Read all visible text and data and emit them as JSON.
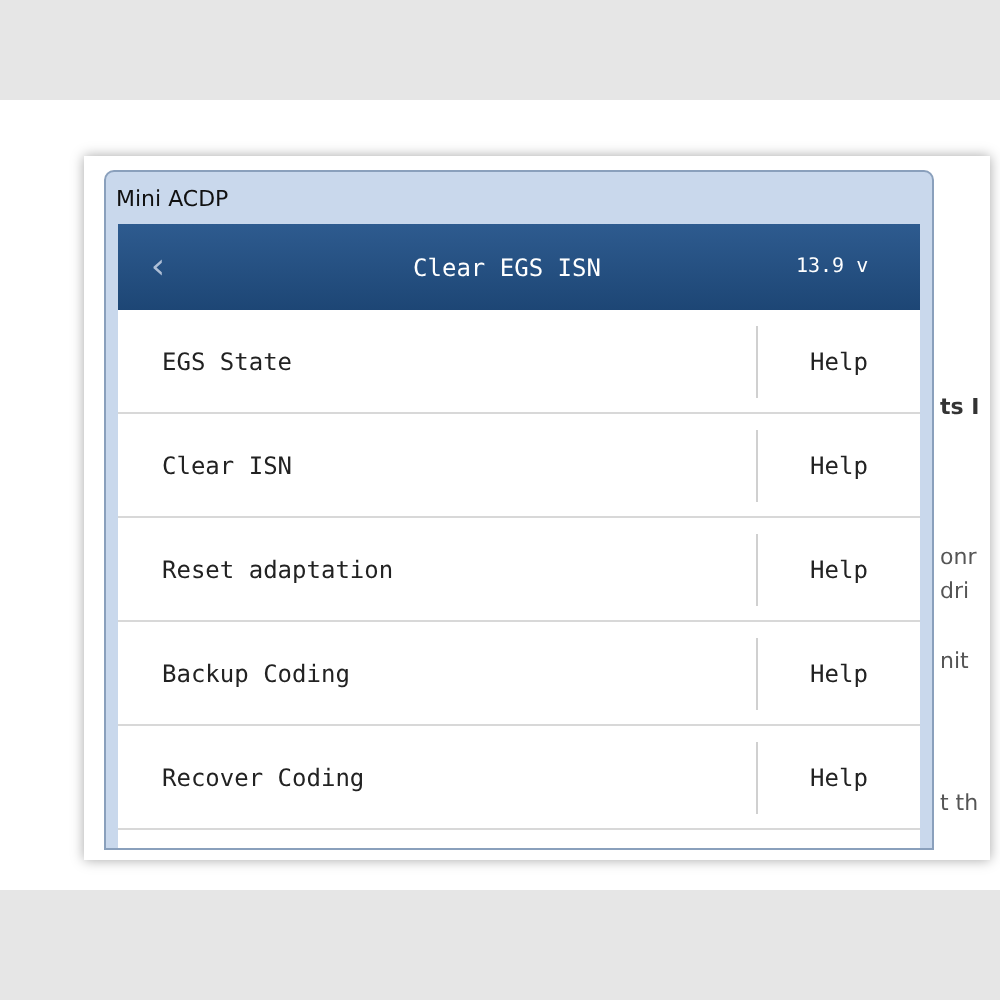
{
  "window": {
    "title": "Mini ACDP"
  },
  "header": {
    "back": "‹",
    "title": "Clear EGS ISN",
    "voltage": "13.9 v"
  },
  "rows": [
    {
      "label": "EGS State",
      "help": "Help"
    },
    {
      "label": "Clear ISN",
      "help": "Help"
    },
    {
      "label": "Reset adaptation",
      "help": "Help"
    },
    {
      "label": "Backup Coding",
      "help": "Help"
    },
    {
      "label": "Recover Coding",
      "help": "Help"
    }
  ],
  "background_fragments": [
    {
      "text": "ts I",
      "bold": true
    },
    {
      "text": "onr",
      "bold": false
    },
    {
      "text": "dri",
      "bold": false
    },
    {
      "text": "nit",
      "bold": false
    },
    {
      "text": "t th",
      "bold": false
    }
  ]
}
